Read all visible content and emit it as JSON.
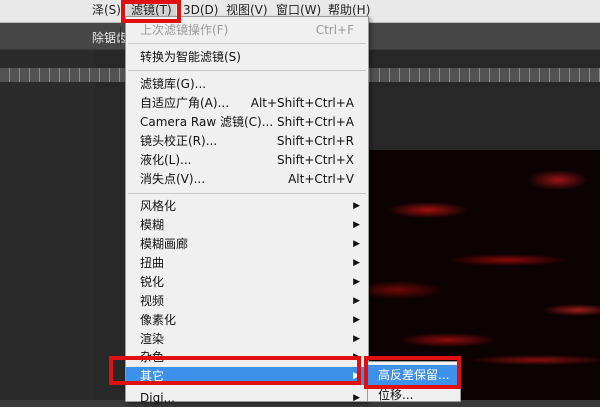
{
  "menubar": {
    "items": [
      {
        "label": "泽(S)"
      },
      {
        "label": "滤镜(T)"
      },
      {
        "label": "3D(D)"
      },
      {
        "label": "视图(V)"
      },
      {
        "label": "窗口(W)"
      },
      {
        "label": "帮助(H)"
      }
    ]
  },
  "options_bar": {
    "text": "除锯齿"
  },
  "filter_menu": {
    "last_filter": {
      "label": "上次滤镜操作(F)",
      "shortcut": "Ctrl+F"
    },
    "convert_smart": {
      "label": "转换为智能滤镜(S)"
    },
    "items": [
      {
        "label": "滤镜库(G)...",
        "shortcut": ""
      },
      {
        "label": "自适应广角(A)...",
        "shortcut": "Alt+Shift+Ctrl+A"
      },
      {
        "label": "Camera Raw 滤镜(C)...",
        "shortcut": "Shift+Ctrl+A"
      },
      {
        "label": "镜头校正(R)...",
        "shortcut": "Shift+Ctrl+R"
      },
      {
        "label": "液化(L)...",
        "shortcut": "Shift+Ctrl+X"
      },
      {
        "label": "消失点(V)...",
        "shortcut": "Alt+Ctrl+V"
      }
    ],
    "submenus": [
      {
        "label": "风格化"
      },
      {
        "label": "模糊"
      },
      {
        "label": "模糊画廊"
      },
      {
        "label": "扭曲"
      },
      {
        "label": "锐化"
      },
      {
        "label": "视频"
      },
      {
        "label": "像素化"
      },
      {
        "label": "渲染"
      },
      {
        "label": "杂色"
      },
      {
        "label": "其它"
      },
      {
        "label": "Digi..."
      }
    ]
  },
  "other_submenu": {
    "items": [
      {
        "label": "高反差保留..."
      },
      {
        "label": "位移..."
      }
    ]
  },
  "colors": {
    "highlight": "#3e91ea",
    "annotation": "#e01010"
  }
}
